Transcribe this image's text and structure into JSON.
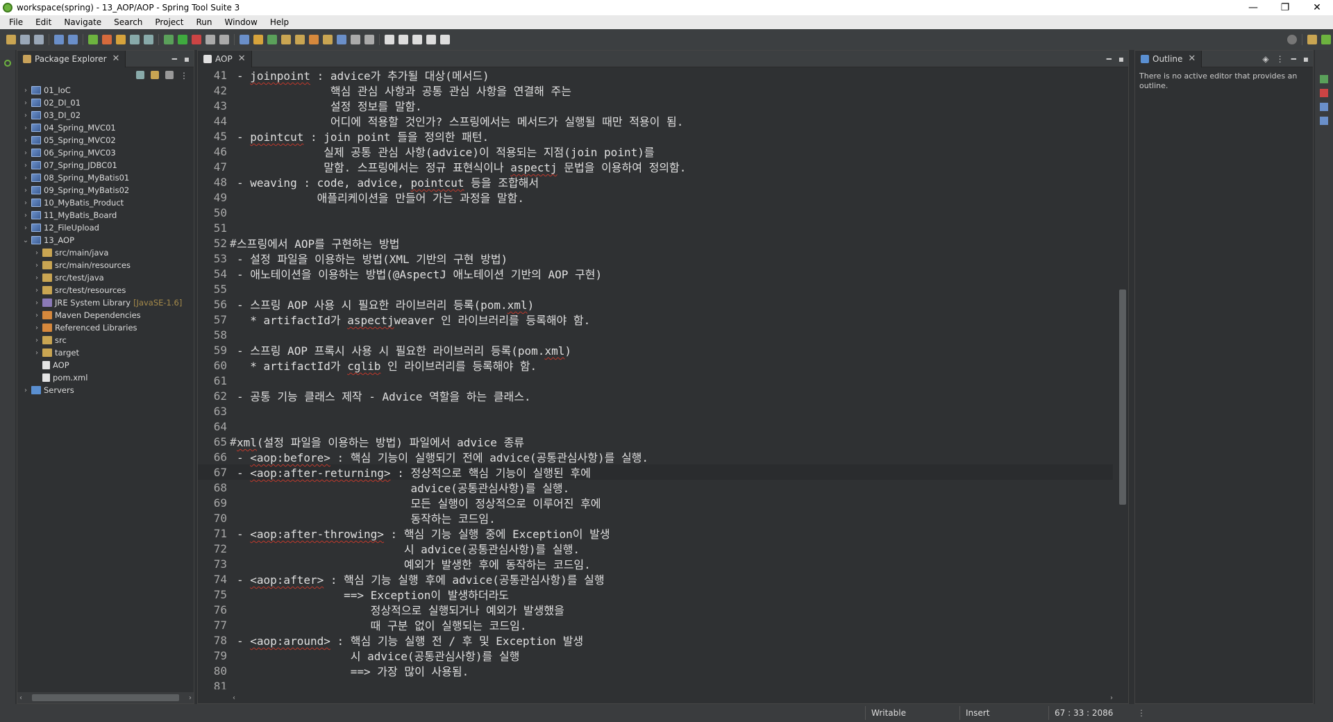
{
  "window": {
    "title": "workspace(spring) - 13_AOP/AOP - Spring Tool Suite 3",
    "minimize": "—",
    "maximize": "❐",
    "close": "✕"
  },
  "menubar": [
    "File",
    "Edit",
    "Navigate",
    "Search",
    "Project",
    "Run",
    "Window",
    "Help"
  ],
  "package_explorer": {
    "tab_label": "Package Explorer",
    "tree": [
      {
        "label": "01_IoC",
        "indent": 0,
        "arrow": "›",
        "icon": "project"
      },
      {
        "label": "02_DI_01",
        "indent": 0,
        "arrow": "›",
        "icon": "project"
      },
      {
        "label": "03_DI_02",
        "indent": 0,
        "arrow": "›",
        "icon": "project"
      },
      {
        "label": "04_Spring_MVC01",
        "indent": 0,
        "arrow": "›",
        "icon": "project"
      },
      {
        "label": "05_Spring_MVC02",
        "indent": 0,
        "arrow": "›",
        "icon": "project"
      },
      {
        "label": "06_Spring_MVC03",
        "indent": 0,
        "arrow": "›",
        "icon": "project"
      },
      {
        "label": "07_Spring_JDBC01",
        "indent": 0,
        "arrow": "›",
        "icon": "project"
      },
      {
        "label": "08_Spring_MyBatis01",
        "indent": 0,
        "arrow": "›",
        "icon": "project"
      },
      {
        "label": "09_Spring_MyBatis02",
        "indent": 0,
        "arrow": "›",
        "icon": "project"
      },
      {
        "label": "10_MyBatis_Product",
        "indent": 0,
        "arrow": "›",
        "icon": "project"
      },
      {
        "label": "11_MyBatis_Board",
        "indent": 0,
        "arrow": "›",
        "icon": "project"
      },
      {
        "label": "12_FileUpload",
        "indent": 0,
        "arrow": "›",
        "icon": "project"
      },
      {
        "label": "13_AOP",
        "indent": 0,
        "arrow": "⌄",
        "icon": "project"
      },
      {
        "label": "src/main/java",
        "indent": 1,
        "arrow": "›",
        "icon": "folder"
      },
      {
        "label": "src/main/resources",
        "indent": 1,
        "arrow": "›",
        "icon": "folder"
      },
      {
        "label": "src/test/java",
        "indent": 1,
        "arrow": "›",
        "icon": "folder"
      },
      {
        "label": "src/test/resources",
        "indent": 1,
        "arrow": "›",
        "icon": "folder"
      },
      {
        "label": "JRE System Library",
        "decor": "[JavaSE-1.6]",
        "indent": 1,
        "arrow": "›",
        "icon": "lib"
      },
      {
        "label": "Maven Dependencies",
        "indent": 1,
        "arrow": "›",
        "icon": "maven"
      },
      {
        "label": "Referenced Libraries",
        "indent": 1,
        "arrow": "›",
        "icon": "maven"
      },
      {
        "label": "src",
        "indent": 1,
        "arrow": "›",
        "icon": "folder"
      },
      {
        "label": "target",
        "indent": 1,
        "arrow": "›",
        "icon": "folder"
      },
      {
        "label": "AOP",
        "indent": 1,
        "arrow": "",
        "icon": "file"
      },
      {
        "label": "pom.xml",
        "indent": 1,
        "arrow": "",
        "icon": "file"
      },
      {
        "label": "Servers",
        "indent": 0,
        "arrow": "›",
        "icon": "servers"
      }
    ]
  },
  "editor": {
    "tab_label": "AOP",
    "lines": [
      {
        "n": "41",
        "text": "- joinpoint : advice가 추가될 대상(메서드)"
      },
      {
        "n": "42",
        "text": "              핵심 관심 사항과 공통 관심 사항을 연결해 주는"
      },
      {
        "n": "43",
        "text": "              설정 정보를 말함."
      },
      {
        "n": "44",
        "text": "              어디에 적용할 것인가? 스프링에서는 메서드가 실행될 때만 적용이 됨."
      },
      {
        "n": "45",
        "text": "- pointcut : join point 들을 정의한 패턴."
      },
      {
        "n": "46",
        "text": "             실제 공통 관심 사항(advice)이 적용되는 지점(join point)를"
      },
      {
        "n": "47",
        "text": "             말함. 스프링에서는 정규 표현식이나 aspectj 문법을 이용하여 정의함."
      },
      {
        "n": "48",
        "text": "- weaving : code, advice, pointcut 등을 조합해서"
      },
      {
        "n": "49",
        "text": "            애플리케이션을 만들어 가는 과정을 말함."
      },
      {
        "n": "50",
        "text": ""
      },
      {
        "n": "51",
        "text": ""
      },
      {
        "n": "52",
        "text": "스프링에서 AOP를 구현하는 방법",
        "marker": "#"
      },
      {
        "n": "53",
        "text": "- 설정 파일을 이용하는 방법(XML 기반의 구현 방법)"
      },
      {
        "n": "54",
        "text": "- 애노테이션을 이용하는 방법(@AspectJ 애노테이션 기반의 AOP 구현)"
      },
      {
        "n": "55",
        "text": ""
      },
      {
        "n": "56",
        "text": "- 스프링 AOP 사용 시 필요한 라이브러리 등록(pom.xml)"
      },
      {
        "n": "57",
        "text": "  * artifactId가 aspectjweaver 인 라이브러리를 등록해야 함."
      },
      {
        "n": "58",
        "text": ""
      },
      {
        "n": "59",
        "text": "- 스프링 AOP 프록시 사용 시 필요한 라이브러리 등록(pom.xml)"
      },
      {
        "n": "60",
        "text": "  * artifactId가 cglib 인 라이브러리를 등록해야 함."
      },
      {
        "n": "61",
        "text": ""
      },
      {
        "n": "62",
        "text": "- 공통 기능 클래스 제작 - Advice 역할을 하는 클래스."
      },
      {
        "n": "63",
        "text": ""
      },
      {
        "n": "64",
        "text": ""
      },
      {
        "n": "65",
        "text": "xml(설정 파일을 이용하는 방법) 파일에서 advice 종류",
        "marker": "#"
      },
      {
        "n": "66",
        "text": "- <aop:before> : 핵심 기능이 실행되기 전에 advice(공통관심사항)를 실행."
      },
      {
        "n": "67",
        "text": "- <aop:after-returning> : 정상적으로 핵심 기능이 실행된 후에",
        "current": true
      },
      {
        "n": "68",
        "text": "                          advice(공통관심사항)를 실행."
      },
      {
        "n": "69",
        "text": "                          모든 실행이 정상적으로 이루어진 후에"
      },
      {
        "n": "70",
        "text": "                          동작하는 코드임."
      },
      {
        "n": "71",
        "text": "- <aop:after-throwing> : 핵심 기능 실행 중에 Exception이 발생"
      },
      {
        "n": "72",
        "text": "                         시 advice(공통관심사항)를 실행."
      },
      {
        "n": "73",
        "text": "                         예외가 발생한 후에 동작하는 코드임."
      },
      {
        "n": "74",
        "text": "- <aop:after> : 핵심 기능 실행 후에 advice(공통관심사항)를 실행"
      },
      {
        "n": "75",
        "text": "                ==> Exception이 발생하더라도"
      },
      {
        "n": "76",
        "text": "                    정상적으로 실행되거나 예외가 발생했을"
      },
      {
        "n": "77",
        "text": "                    때 구분 없이 실행되는 코드임."
      },
      {
        "n": "78",
        "text": "- <aop:around> : 핵심 기능 실행 전 / 후 및 Exception 발생"
      },
      {
        "n": "79",
        "text": "                 시 advice(공통관심사항)를 실행"
      },
      {
        "n": "80",
        "text": "                 ==> 가장 많이 사용됨."
      },
      {
        "n": "81",
        "text": ""
      }
    ],
    "squiggles": [
      "joinpoint",
      "pointcut",
      "aspectj",
      "aspectjweaver",
      "cglib",
      "xml",
      "<aop:before>",
      "<aop:after-returning>",
      "<aop:after-throwing>",
      "<aop:after>",
      "<aop:around>"
    ]
  },
  "outline": {
    "tab_label": "Outline",
    "message": "There is no active editor that provides an outline."
  },
  "statusbar": {
    "writable": "Writable",
    "insert": "Insert",
    "position": "67 : 33 : 2086"
  },
  "colors": {
    "background": "#2f3133",
    "accent_green": "#6db33f",
    "squiggle": "#c0392b"
  }
}
